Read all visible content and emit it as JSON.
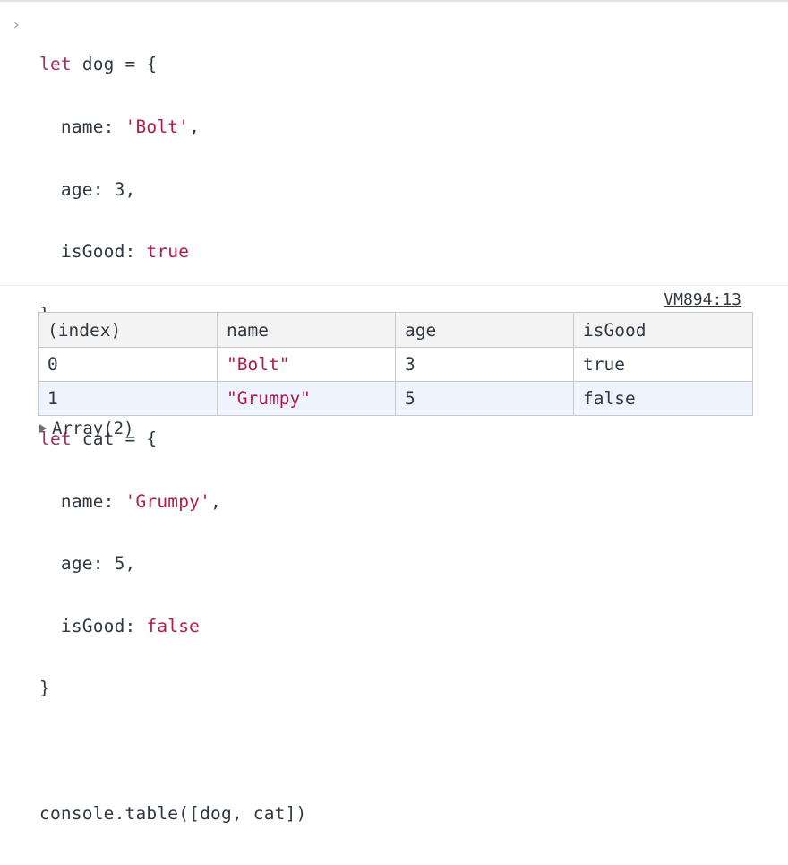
{
  "console": {
    "prompt_symbol": "›",
    "source_link": "VM894:13",
    "array_summary": "Array(2)"
  },
  "code": {
    "dog_decl_keyword": "let",
    "dog_decl_rest": " dog = {",
    "dog_name_key": "  name: ",
    "dog_name_value": "'Bolt'",
    "dog_name_comma": ",",
    "dog_age": "  age: 3,",
    "dog_isgood_key": "  isGood: ",
    "dog_isgood_value": "true",
    "dog_close": "}",
    "cat_decl_keyword": "let",
    "cat_decl_rest": " cat = {",
    "cat_name_key": "  name: ",
    "cat_name_value": "'Grumpy'",
    "cat_name_comma": ",",
    "cat_age": "  age: 5,",
    "cat_isgood_key": "  isGood: ",
    "cat_isgood_value": "false",
    "cat_close": "}",
    "table_call": "console.table([dog, cat])"
  },
  "table": {
    "headers": [
      "(index)",
      "name",
      "age",
      "isGood"
    ],
    "rows": [
      [
        "0",
        "\"Bolt\"",
        "3",
        "true"
      ],
      [
        "1",
        "\"Grumpy\"",
        "5",
        "false"
      ]
    ]
  },
  "colors": {
    "keyword": "#a0305b",
    "string": "#b21d4a",
    "text": "#303942",
    "header_bg": "#f3f3f3",
    "alt_row_bg": "#eef3fd",
    "grid": "#c9c9c9"
  },
  "icons": {
    "prompt": "chevron-right-icon",
    "expand": "triangle-right-icon"
  }
}
